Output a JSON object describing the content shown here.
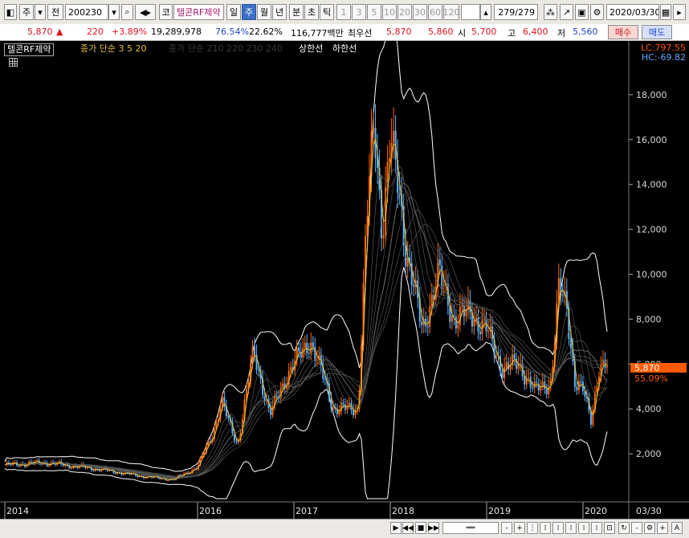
{
  "toolbar": {
    "type_select": "주",
    "prev_label": "전",
    "code": "200230",
    "code_prefix": "코",
    "stock_name": "텔콘RF제약",
    "period_tabs": [
      "일",
      "주",
      "월",
      "년",
      "분",
      "초",
      "틱"
    ],
    "selected_period": "주",
    "minute_buttons": [
      "1",
      "3",
      "5",
      "10",
      "20",
      "30",
      "60",
      "120"
    ],
    "page_counter": "279/279",
    "date": "2020/03/30"
  },
  "info": {
    "price": "5,870",
    "direction": "▲",
    "change": "220",
    "change_pct": "+3.89%",
    "volume": "19,289,978",
    "ratio1": "76.54%",
    "ratio2": "22.62%",
    "amount": "116,777백만",
    "priority_label": "최우선",
    "ask": "5,870",
    "bid": "5,860",
    "open_label": "시",
    "open": "5,700",
    "high_label": "고",
    "high": "6,400",
    "low_label": "저",
    "low": "5,560",
    "buy_label": "매수",
    "sell_label": "매도"
  },
  "chart": {
    "legend_name": "텔콘RF제약",
    "legend_ma_short": "종가 단순 3  5  20",
    "legend_ma_long": "종가 단순 210 220 230 240",
    "legend_upper": "상한선",
    "legend_lower": "하한선",
    "lc_label": "LC:797.55",
    "hc_label": "HC:-69.82",
    "price_tag": "5,870",
    "pct_tag": "55.09%",
    "last_date": "03/30",
    "colors": {
      "candle_up": "#ff6a00",
      "candle_down": "#5fb4ff",
      "ma_short": "#e8c040",
      "bands": "#ffffff",
      "price_tag_bg": "#ff5a00"
    }
  },
  "chart_data": {
    "type": "line",
    "x_tick_labels": [
      "2014",
      "2016",
      "2017",
      "2018",
      "2019",
      "2020"
    ],
    "y_tick_labels": [
      "2,000",
      "4,000",
      "6,000",
      "8,000",
      "10,000",
      "12,000",
      "14,000",
      "16,000",
      "18,000"
    ],
    "ylim": [
      0,
      19500
    ],
    "x_dates": [
      "2014-01",
      "2014-06",
      "2015-01",
      "2015-06",
      "2015-10",
      "2016-01",
      "2016-03",
      "2016-04",
      "2016-05",
      "2016-06",
      "2016-08",
      "2016-10",
      "2016-12",
      "2017-03",
      "2017-06",
      "2017-09",
      "2017-10",
      "2017-11",
      "2017-12",
      "2018-01",
      "2018-02",
      "2018-03",
      "2018-05",
      "2018-07",
      "2018-09",
      "2018-11",
      "2019-01",
      "2019-03",
      "2019-05",
      "2019-07",
      "2019-09",
      "2019-10",
      "2019-11",
      "2019-12",
      "2020-01",
      "2020-02",
      "2020-03"
    ],
    "series": [
      {
        "values": [
          1500,
          1600,
          1300,
          1000,
          850,
          1400,
          3000,
          4300,
          3300,
          2400,
          6600,
          3700,
          5400,
          7100,
          4000,
          4000,
          12000,
          16800,
          12000,
          15800,
          14000,
          11000,
          7500,
          10000,
          8000,
          8300,
          7500,
          5800,
          6000,
          4800,
          5200,
          9300,
          8500,
          5200,
          4800,
          3500,
          5870
        ]
      }
    ],
    "grid": false,
    "legend": "top-left"
  },
  "bottom": {
    "zoom_minus": "-",
    "zoom_plus": "+",
    "font_label": "A"
  }
}
